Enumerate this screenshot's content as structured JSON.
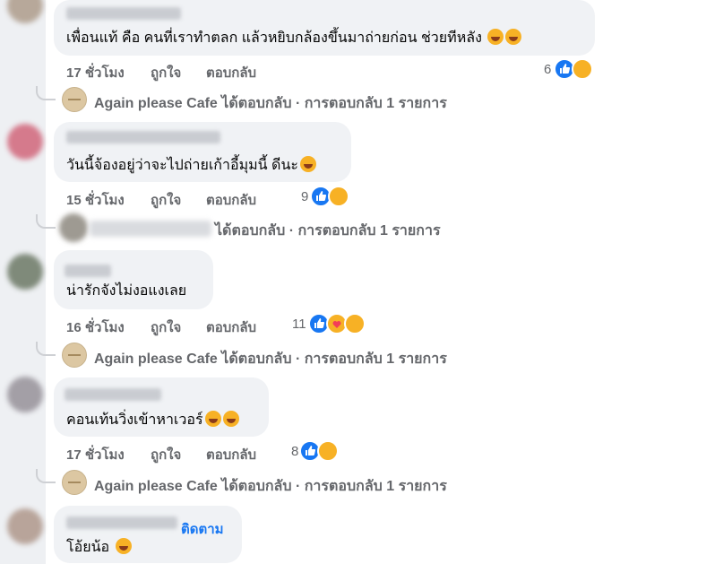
{
  "comments": [
    {
      "text": "เพื่อนแท้ คือ คนที่เราทำตลก แล้วหยิบกล้องขึ้นมาถ่ายก่อน ช่วยทีหลัง",
      "emojis": [
        "rofl-emoji",
        "rofl-emoji"
      ],
      "time": "17 ชั่วโมง",
      "like_label": "ถูกใจ",
      "reply_label": "ตอบกลับ",
      "reaction_count": "6",
      "reactions": [
        "like",
        "haha"
      ]
    },
    {
      "text": "วันนี้จ้องอยู่ว่าจะไปถ่ายเก้าอี้มุมนี้ ดีนะ",
      "emojis": [
        "grin-sweat-emoji"
      ],
      "time": "15 ชั่วโมง",
      "like_label": "ถูกใจ",
      "reply_label": "ตอบกลับ",
      "reaction_count": "9",
      "reactions": [
        "like",
        "haha"
      ]
    },
    {
      "text": "น่ารักจังไม่งอแงเลย",
      "emojis": [],
      "time": "16 ชั่วโมง",
      "like_label": "ถูกใจ",
      "reply_label": "ตอบกลับ",
      "reaction_count": "11",
      "reactions": [
        "like",
        "care",
        "haha"
      ]
    },
    {
      "text": "คอนเท้นวิ่งเข้าหาเวอร์",
      "emojis": [
        "grin-sweat-emoji",
        "grin-sweat-emoji"
      ],
      "time": "17 ชั่วโมง",
      "like_label": "ถูกใจ",
      "reply_label": "ตอบกลับ",
      "reaction_count": "8",
      "reactions": [
        "like",
        "haha"
      ]
    },
    {
      "text": "โอ้ยน้อ",
      "emojis": [
        "joy-emoji"
      ],
      "follow_label": "ติดตาม"
    }
  ],
  "replies": [
    {
      "page_name": "Again please Cafe",
      "text": " ได้ตอบกลับ · การตอบกลับ 1 รายการ"
    },
    {
      "text": "ได้ตอบกลับ · การตอบกลับ 1 รายการ"
    },
    {
      "page_name": "Again please Cafe",
      "text": " ได้ตอบกลับ · การตอบกลับ 1 รายการ"
    },
    {
      "page_name": "Again please Cafe",
      "text": " ได้ตอบกลับ · การตอบกลับ 1 รายการ"
    }
  ],
  "colors": {
    "bubble": "#f0f2f5",
    "meta_text": "#65676b",
    "like_blue": "#1877f2",
    "haha_yellow": "#f7b125"
  }
}
